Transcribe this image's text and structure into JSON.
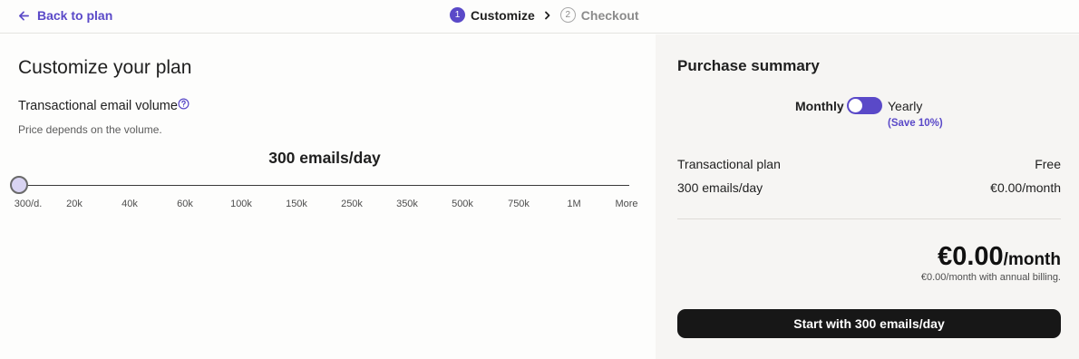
{
  "nav": {
    "back_label": "Back to plan",
    "steps": [
      {
        "num": "1",
        "label": "Customize",
        "active": true
      },
      {
        "num": "2",
        "label": "Checkout",
        "active": false
      }
    ]
  },
  "customize": {
    "title": "Customize your plan",
    "volume_label": "Transactional email volume",
    "volume_sub": "Price depends on the volume.",
    "current_value": "300 emails/day",
    "slider_ticks": [
      "300/d.",
      "20k",
      "40k",
      "60k",
      "100k",
      "150k",
      "250k",
      "350k",
      "500k",
      "750k",
      "1M",
      "More"
    ],
    "slider_selected_index": 0
  },
  "summary": {
    "title": "Purchase summary",
    "billing": {
      "monthly": "Monthly",
      "yearly": "Yearly",
      "save": "(Save 10%)",
      "yearly_selected": false
    },
    "lines": [
      {
        "label": "Transactional plan",
        "value": "Free"
      },
      {
        "label": "300 emails/day",
        "value": "€0.00/month"
      }
    ],
    "total_amount": "€0.00",
    "total_unit": "/month",
    "annual_note": "€0.00/month with annual billing.",
    "cta_label": "Start with 300 emails/day"
  },
  "colors": {
    "accent": "#5a49c8",
    "cta_bg": "#171717",
    "summary_bg": "#f6f5f3",
    "page_bg": "#fdfdfc"
  },
  "icons": {
    "back": "arrow-left-icon",
    "help": "question-circle-icon",
    "step_separator": "chevron-right-icon"
  }
}
